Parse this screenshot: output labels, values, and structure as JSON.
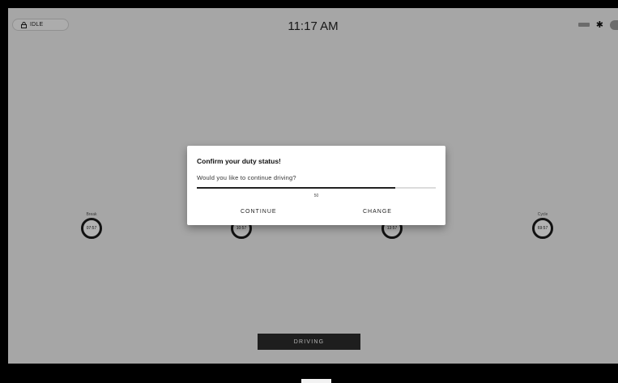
{
  "status_pill": {
    "label": "IDLE",
    "icon": "lock-icon"
  },
  "clock": "11:17 AM",
  "status_icons": {
    "battery": "battery-icon",
    "bluetooth": "bluetooth-icon",
    "bluetooth_glyph": "✱"
  },
  "gauges": [
    {
      "label": "Break",
      "value": "07:57"
    },
    {
      "label": "",
      "value": "10:57"
    },
    {
      "label": "",
      "value": "13:57"
    },
    {
      "label": "Cycle",
      "value": "69:57"
    }
  ],
  "duty_button": "DRIVING",
  "dialog": {
    "title": "Confirm your duty status!",
    "message": "Would you like to continue driving?",
    "slider_value": "50",
    "slider_fraction": 0.83,
    "continue_label": "CONTINUE",
    "change_label": "CHANGE"
  }
}
